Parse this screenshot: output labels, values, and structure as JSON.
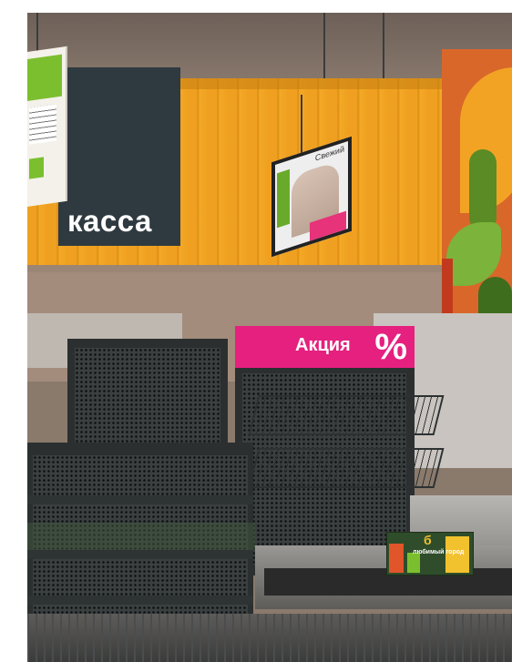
{
  "scene": {
    "kassa_label": "касса",
    "promo_label": "Акция",
    "promo_symbol": "%",
    "brand_number": "б",
    "brand_name": "любимый город",
    "tv_caption": "Свежий",
    "colors": {
      "orange_wall": "#f0a020",
      "kassa_panel": "#2f3a40",
      "promo_pink": "#e6207f",
      "brand_green": "#2f4d2a"
    }
  }
}
